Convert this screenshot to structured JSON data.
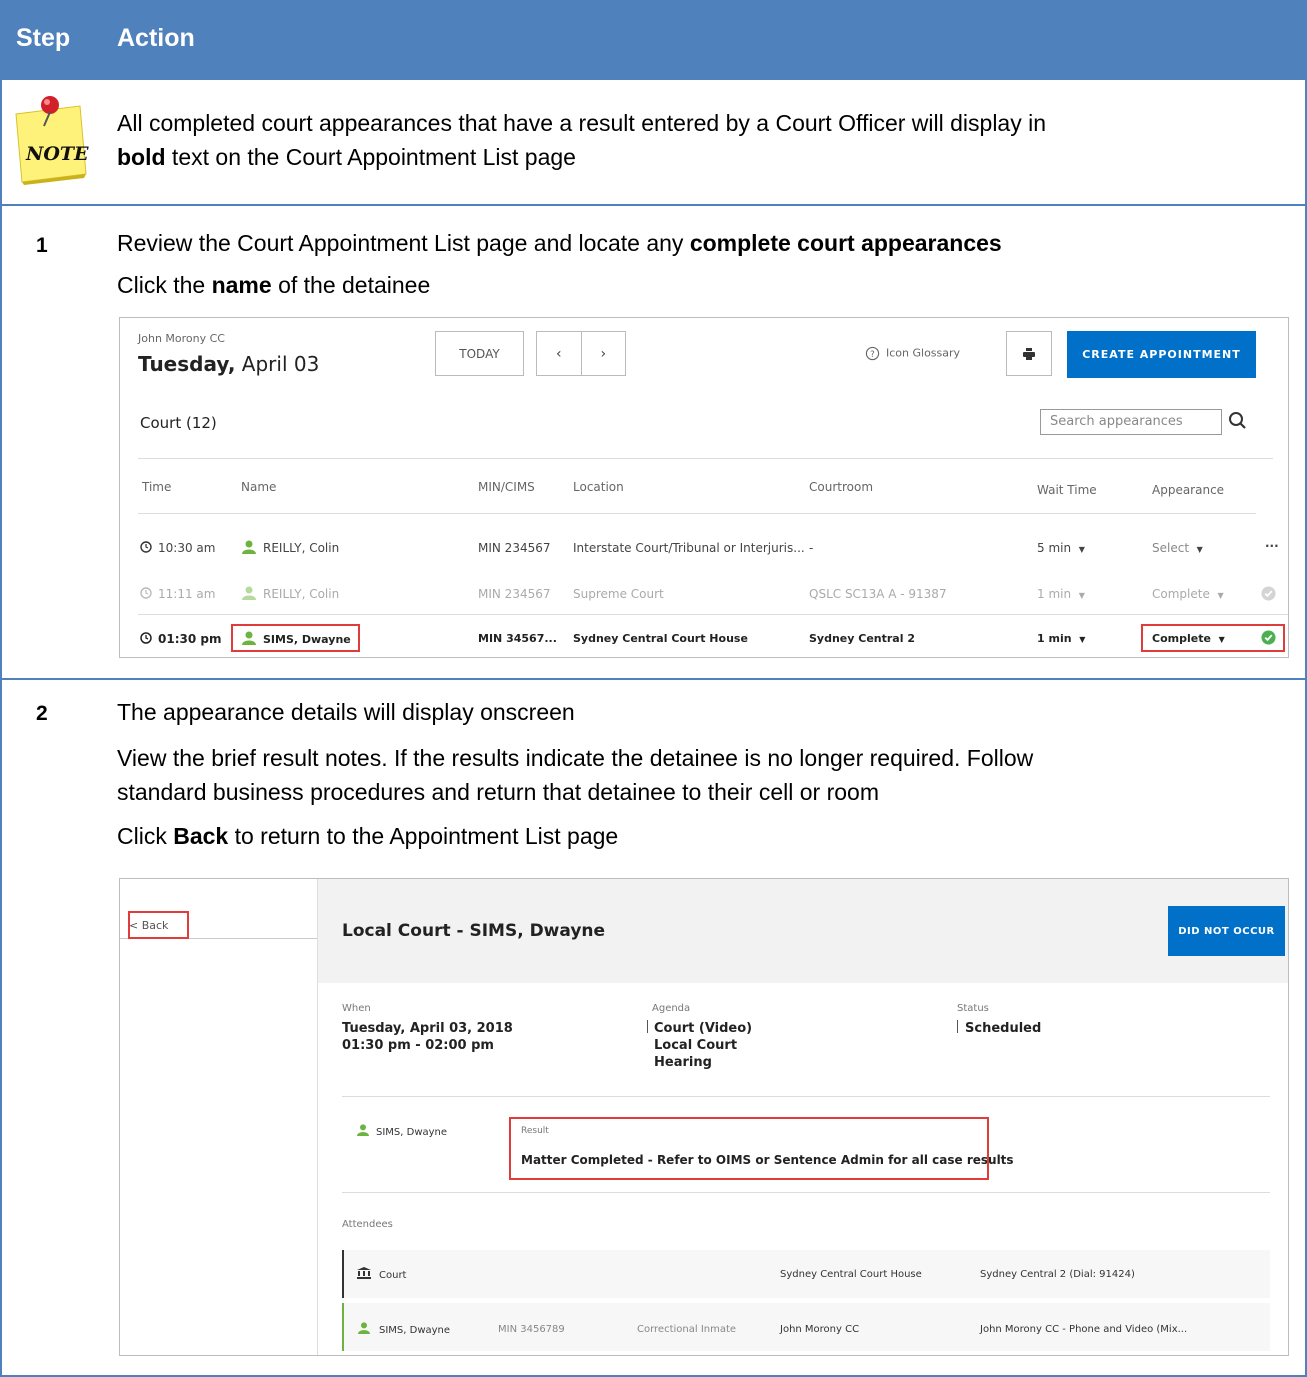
{
  "header": {
    "step_label": "Step",
    "action_label": "Action"
  },
  "note": {
    "icon_text": "NOTE",
    "line1": "All completed court appearances that have a result entered by a Court Officer will display in",
    "line2_bold": "bold",
    "line2_rest": " text on the Court Appointment List page"
  },
  "step1": {
    "number": "1",
    "line1_a": "Review the Court Appointment List page and locate any ",
    "line1_b": "complete court appearances",
    "line2_a": "Click the ",
    "line2_b": "name",
    "line2_c": " of the detainee"
  },
  "step2": {
    "number": "2",
    "line1": "The appearance details will display onscreen",
    "line2": "View the brief result notes. If the results indicate the detainee is no longer required. Follow",
    "line3": "standard business procedures and return that detainee to their cell or room",
    "line4_a": "Click ",
    "line4_b": "Back",
    "line4_c": " to return to the Appointment List page"
  },
  "shot1": {
    "facility": "John Morony CC",
    "day": "Tuesday,",
    "date": " April 03",
    "today_btn": "TODAY",
    "prev": "‹",
    "next": "›",
    "glossary": "Icon Glossary",
    "create_btn": "CREATE APPOINTMENT",
    "court_count": "Court (12)",
    "search_placeholder": "Search appearances",
    "columns": {
      "time": "Time",
      "name": "Name",
      "min": "MIN/CIMS",
      "location": "Location",
      "courtroom": "Courtroom",
      "wait": "Wait Time",
      "appearance": "Appearance"
    },
    "rows": [
      {
        "time": "10:30 am",
        "name": "REILLY, Colin",
        "min": "MIN 234567",
        "location": "Interstate Court/Tribunal or Interjuris...",
        "courtroom": "-",
        "wait": "5 min",
        "appearance": "Select",
        "more": "···"
      },
      {
        "time": "11:11 am",
        "name": "REILLY, Colin",
        "min": "MIN 234567",
        "location": "Supreme Court",
        "courtroom": "QSLC SC13A A - 91387",
        "wait": "1 min",
        "appearance": "Complete"
      },
      {
        "time": "01:30 pm",
        "name": "SIMS, Dwayne",
        "min": "MIN 34567...",
        "location": "Sydney Central Court House",
        "courtroom": "Sydney Central 2",
        "wait": "1 min",
        "appearance": "Complete"
      }
    ],
    "colors": {
      "accent": "#0070c8",
      "person": "#6cb33f",
      "check": "#4caf50",
      "highlight": "#e03c3c"
    }
  },
  "shot2": {
    "back": "< Back",
    "title": "Local Court - SIMS, Dwayne",
    "dno_btn": "DID NOT OCCUR",
    "when_label": "When",
    "when_line1": "Tuesday, April 03, 2018",
    "when_line2": "01:30 pm - 02:00 pm",
    "agenda_label": "Agenda",
    "agenda_line1": "Court (Video)",
    "agenda_line2": "Local Court",
    "agenda_line3": "Hearing",
    "status_label": "Status",
    "status_value": "Scheduled",
    "person": "SIMS, Dwayne",
    "result_label": "Result",
    "result_value": "Matter Completed - Refer to OIMS or Sentence Admin for all case results",
    "attendees_label": "Attendees",
    "att1": {
      "name": "Court",
      "location": "Sydney Central Court House",
      "room": "Sydney Central 2 (Dial: 91424)"
    },
    "att2": {
      "name": "SIMS, Dwayne",
      "min": "MIN 3456789",
      "type": "Correctional Inmate",
      "location": "John Morony CC",
      "room": "John Morony CC - Phone and Video (Mix..."
    }
  }
}
